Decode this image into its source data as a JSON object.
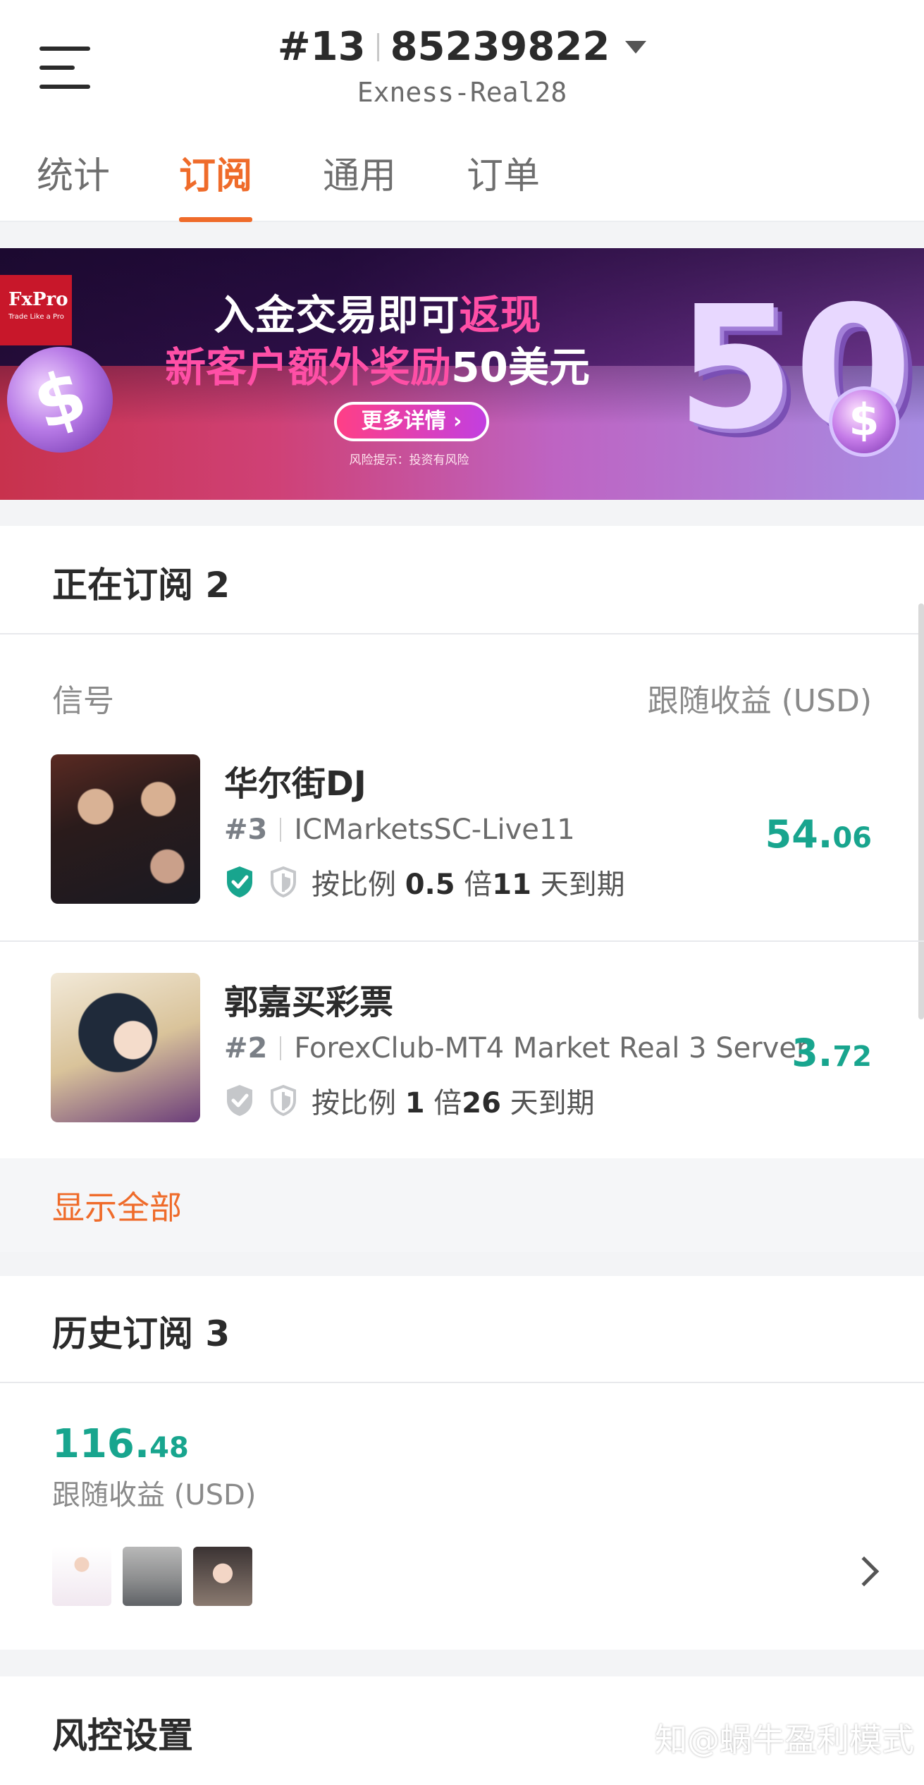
{
  "header": {
    "account_rank": "#13",
    "account_number": "85239822",
    "server": "Exness-Real28"
  },
  "tabs": [
    {
      "label": "统计",
      "active": false
    },
    {
      "label": "订阅",
      "active": true
    },
    {
      "label": "通用",
      "active": false
    },
    {
      "label": "订单",
      "active": false
    }
  ],
  "banner": {
    "brand": "FxPro",
    "brand_tagline": "Trade Like a Pro",
    "line1_prefix": "入金交易即可",
    "line1_highlight": "返现",
    "line2_prefix": "新客户额外奖励",
    "line2_highlight": "50美元",
    "button": "更多详情 ›",
    "risk": "风险提示：投资有风险",
    "big_number": "50",
    "coin_symbol": "$"
  },
  "active": {
    "title": "正在订阅 2",
    "col_signal": "信号",
    "col_profit": "跟随收益 (USD)",
    "items": [
      {
        "name": "华尔街DJ",
        "rank": "#3",
        "server": "ICMarketsSC-Live11",
        "ratio_prefix": "按比例",
        "ratio": "0.5",
        "ratio_unit": "倍",
        "days": "11",
        "days_suffix": "天到期",
        "profit_int": "54.",
        "profit_dec": "06",
        "verified": true
      },
      {
        "name": "郭嘉买彩票",
        "rank": "#2",
        "server": "ForexClub-MT4 Market Real 3 Server",
        "ratio_prefix": "按比例",
        "ratio": "1",
        "ratio_unit": "倍",
        "days": "26",
        "days_suffix": "天到期",
        "profit_int": "3.",
        "profit_dec": "72",
        "verified": false
      }
    ],
    "show_all": "显示全部"
  },
  "history": {
    "title": "历史订阅 3",
    "total_int": "116.",
    "total_dec": "48",
    "total_label": "跟随收益 (USD)"
  },
  "risk": {
    "title": "风控设置"
  },
  "watermark": "知@蜗牛盈利模式",
  "colors": {
    "accent": "#ef6b2a",
    "profit": "#18a58e",
    "verified": "#18a58e",
    "unverified": "#c5c7ca"
  }
}
